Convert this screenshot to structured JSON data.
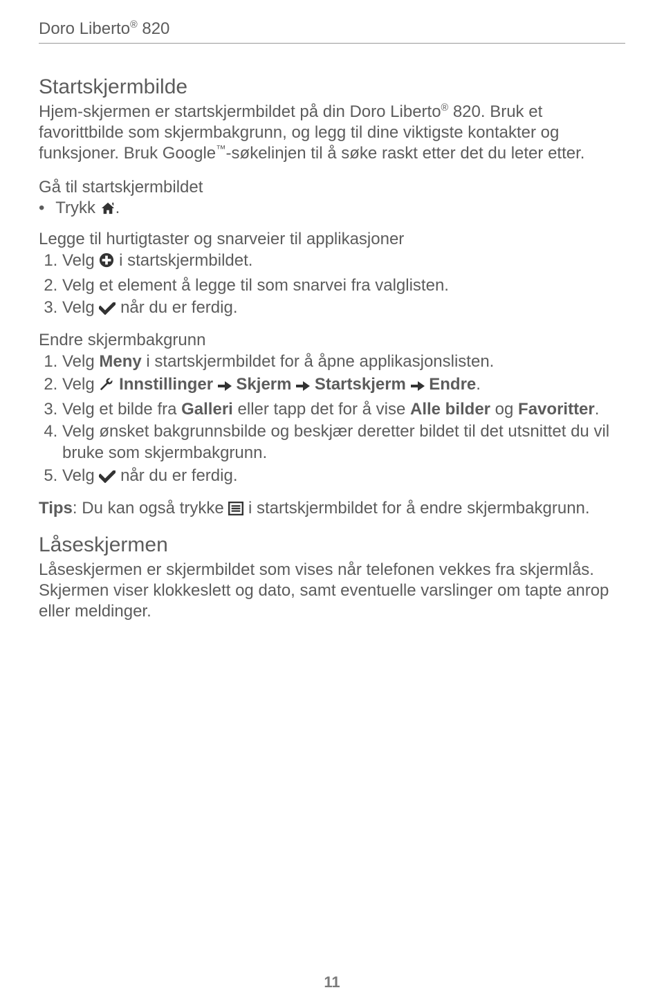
{
  "header": {
    "product": "Doro Liberto® 820"
  },
  "section1": {
    "title": "Startskjermbilde",
    "intro_1": "Hjem-skjermen er startskjermbildet på din Doro Liberto® 820. Bruk et favorittbilde som skjermbakgrunn, og legg til dine viktigste kontakter og funksjoner. Bruk Google™-søkelinjen til å søke raskt etter det du leter etter.",
    "sub1": "Gå til startskjermbildet",
    "bullet1_pre": "Trykk ",
    "bullet1_post": ".",
    "sub2": "Legge til hurtigtaster og snarveier til applikasjoner",
    "list2": {
      "i1_pre": "Velg ",
      "i1_post": " i startskjermbildet.",
      "i2": "Velg et element å legge til som snarvei fra valglisten.",
      "i3_pre": "Velg ",
      "i3_post": " når du er ferdig."
    },
    "sub3": "Endre skjermbakgrunn",
    "list3": {
      "i1_pre": "Velg ",
      "i1_meny": "Meny",
      "i1_post": " i startskjermbildet for å åpne applikasjonslisten.",
      "i2_pre": "Velg ",
      "i2_inst": " Innstillinger ",
      "i2_skj": " Skjerm ",
      "i2_start": " Startskjerm ",
      "i2_endre": " Endre",
      "i2_dot": ".",
      "i3_a": "Velg et bilde fra ",
      "i3_gal": "Galleri",
      "i3_b": " eller tapp det for å vise ",
      "i3_alle": "Alle bilder",
      "i3_c": " og ",
      "i3_fav": "Favoritter",
      "i3_d": ".",
      "i4": "Velg ønsket bakgrunnsbilde og beskjær deretter bildet til det utsnittet du vil bruke som skjermbakgrunn.",
      "i5_pre": "Velg ",
      "i5_post": " når du er ferdig."
    },
    "tip_label": "Tips",
    "tip_pre": ": Du kan også trykke ",
    "tip_post": " i startskjermbildet for å endre skjermbakgrunn."
  },
  "section2": {
    "title": "Låseskjermen",
    "body": "Låseskjermen er skjermbildet som vises når telefonen vekkes fra skjermlås. Skjermen viser klokkeslett og dato, samt eventuelle varslinger om tapte anrop eller meldinger."
  },
  "page_number": "11"
}
